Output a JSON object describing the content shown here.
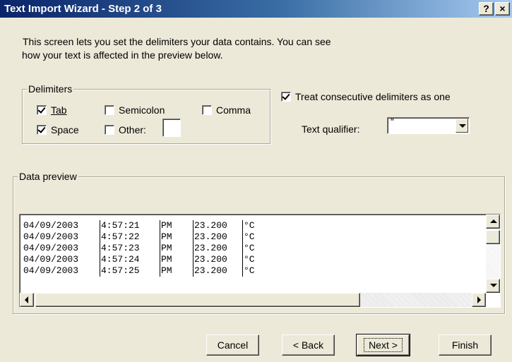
{
  "window": {
    "title": "Text Import Wizard - Step 2 of 3",
    "help_label": "?",
    "close_label": "×"
  },
  "intro": {
    "line1": "This screen lets you set the delimiters your data contains.  You can see",
    "line2": "how your text is affected in the preview below."
  },
  "delimiters": {
    "legend": "Delimiters",
    "tab": {
      "label": "Tab",
      "checked": true
    },
    "semicolon": {
      "label": "Semicolon",
      "checked": false
    },
    "comma": {
      "label": "Comma",
      "checked": false
    },
    "space": {
      "label": "Space",
      "checked": true
    },
    "other": {
      "label": "Other:",
      "checked": false,
      "value": ""
    }
  },
  "consecutive": {
    "label": "Treat consecutive delimiters as one",
    "checked": true
  },
  "qualifier": {
    "label": "Text qualifier:",
    "value": "\""
  },
  "preview": {
    "legend": "Data preview",
    "rows": [
      [
        "04/09/2003",
        "4:57:21",
        "PM",
        "23.200",
        "°C"
      ],
      [
        "04/09/2003",
        "4:57:22",
        "PM",
        "23.200",
        "°C"
      ],
      [
        "04/09/2003",
        "4:57:23",
        "PM",
        "23.200",
        "°C"
      ],
      [
        "04/09/2003",
        "4:57:24",
        "PM",
        "23.200",
        "°C"
      ],
      [
        "04/09/2003",
        "4:57:25",
        "PM",
        "23.200",
        "°C"
      ]
    ]
  },
  "buttons": {
    "cancel": "Cancel",
    "back": "< Back",
    "next": "Next >",
    "finish": "Finish"
  }
}
